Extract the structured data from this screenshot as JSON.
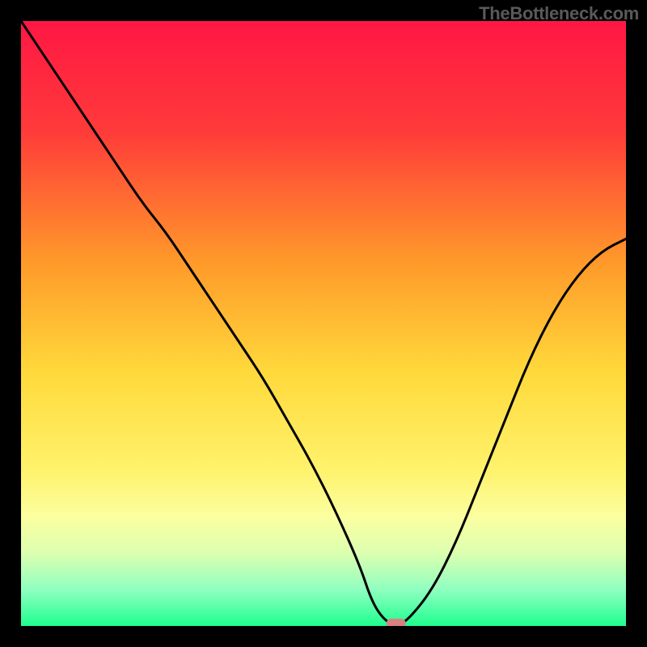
{
  "watermark": "TheBottleneck.com",
  "chart_data": {
    "type": "line",
    "title": "",
    "xlabel": "",
    "ylabel": "",
    "xlim": [
      0,
      100
    ],
    "ylim": [
      0,
      100
    ],
    "gradient_stops": [
      {
        "offset": 0,
        "color": "#ff1744"
      },
      {
        "offset": 18,
        "color": "#ff3a3a"
      },
      {
        "offset": 40,
        "color": "#ff9a2a"
      },
      {
        "offset": 58,
        "color": "#ffd93b"
      },
      {
        "offset": 74,
        "color": "#fff26b"
      },
      {
        "offset": 82,
        "color": "#fbffa0"
      },
      {
        "offset": 88,
        "color": "#dcffb0"
      },
      {
        "offset": 94,
        "color": "#8fffc0"
      },
      {
        "offset": 100,
        "color": "#1fff8f"
      }
    ],
    "series": [
      {
        "name": "bottleneck-curve",
        "x": [
          0,
          4,
          8,
          12,
          16,
          20,
          24,
          28,
          32,
          36,
          40,
          44,
          48,
          52,
          56,
          58,
          60,
          62,
          64,
          68,
          72,
          76,
          80,
          84,
          88,
          92,
          96,
          100
        ],
        "y": [
          100,
          94,
          88,
          82,
          76,
          70,
          65,
          59,
          53,
          47,
          41,
          34,
          27,
          19,
          10,
          4,
          1,
          0,
          1,
          6,
          14,
          24,
          34,
          44,
          52,
          58,
          62,
          64
        ]
      }
    ],
    "optimal_marker": {
      "x": 62,
      "y": 0,
      "color": "#d98080"
    }
  }
}
